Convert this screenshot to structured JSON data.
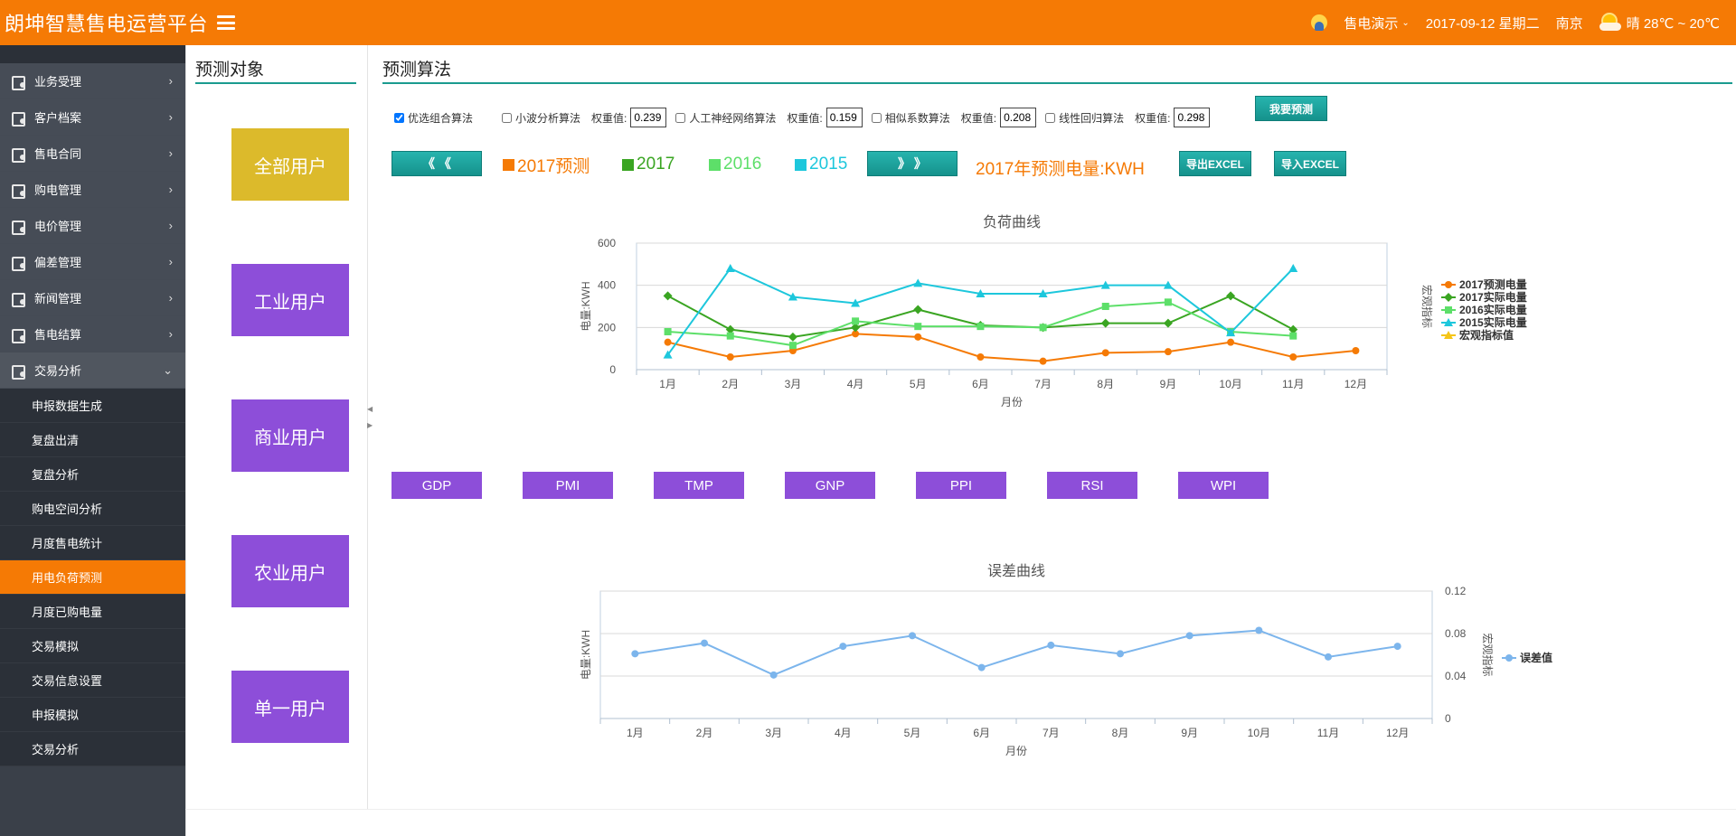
{
  "header": {
    "brand": "朗坤智慧售电运营平台",
    "user": "售电演示",
    "date": "2017-09-12 星期二",
    "city": "南京",
    "weather": "晴 28℃ ~ 20℃"
  },
  "sidebar": {
    "items": [
      {
        "label": "业务受理"
      },
      {
        "label": "客户档案"
      },
      {
        "label": "售电合同"
      },
      {
        "label": "购电管理"
      },
      {
        "label": "电价管理"
      },
      {
        "label": "偏差管理"
      },
      {
        "label": "新闻管理"
      },
      {
        "label": "售电结算"
      },
      {
        "label": "交易分析"
      }
    ],
    "subitems": [
      {
        "label": "申报数据生成"
      },
      {
        "label": "复盘出清"
      },
      {
        "label": "复盘分析"
      },
      {
        "label": "购电空间分析"
      },
      {
        "label": "月度售电统计"
      },
      {
        "label": "用电负荷预测"
      },
      {
        "label": "月度已购电量"
      },
      {
        "label": "交易模拟"
      },
      {
        "label": "交易信息设置"
      },
      {
        "label": "申报模拟"
      },
      {
        "label": "交易分析"
      }
    ]
  },
  "target_panel": {
    "title": "预测对象",
    "buttons": [
      "全部用户",
      "工业用户",
      "商业用户",
      "农业用户",
      "单一用户"
    ]
  },
  "algo_panel": {
    "title": "预测算法",
    "algorithms": [
      {
        "label": "优选组合算法",
        "checked": true
      },
      {
        "label": "小波分析算法",
        "checked": false,
        "weight_label": "权重值:",
        "weight": "0.239"
      },
      {
        "label": "人工神经网络算法",
        "checked": false,
        "weight_label": "权重值:",
        "weight": "0.159"
      },
      {
        "label": "相似系数算法",
        "checked": false,
        "weight_label": "权重值:",
        "weight": "0.208"
      },
      {
        "label": "线性回归算法",
        "checked": false,
        "weight_label": "权重值:",
        "weight": "0.298"
      }
    ],
    "predict_btn": "我要预测",
    "prev_btn": "《 《",
    "next_btn": "》 》",
    "legend": [
      "2017预测",
      "2017",
      "2016",
      "2015"
    ],
    "unit_label": "2017年预测电量:KWH",
    "export_btn": "导出EXCEL",
    "import_btn": "导入EXCEL",
    "macro_buttons": [
      "GDP",
      "PMI",
      "TMP",
      "GNP",
      "PPI",
      "RSI",
      "WPI"
    ]
  },
  "colors": {
    "orange": "#f57a05",
    "green": "#3aa522",
    "lightgreen": "#5ddf69",
    "cyan": "#1dc7dc",
    "yellow": "#f5c518",
    "blue": "#7cb5ec",
    "purple": "#8d4ed9",
    "teal": "#1a9b8f"
  },
  "chart_data": [
    {
      "type": "line",
      "title": "负荷曲线",
      "xlabel": "月份",
      "ylabel": "电量:KWH",
      "y2label": "宏观指标",
      "categories": [
        "1月",
        "2月",
        "3月",
        "4月",
        "5月",
        "6月",
        "7月",
        "8月",
        "9月",
        "10月",
        "11月",
        "12月"
      ],
      "ylim": [
        0,
        600
      ],
      "yticks": [
        0,
        200,
        400,
        600
      ],
      "series": [
        {
          "name": "2017预测电量",
          "color": "#f57a05",
          "marker": "circle",
          "values": [
            130,
            60,
            90,
            170,
            155,
            60,
            40,
            80,
            85,
            130,
            60,
            90
          ]
        },
        {
          "name": "2017实际电量",
          "color": "#3aa522",
          "marker": "diamond",
          "values": [
            350,
            190,
            155,
            200,
            285,
            210,
            200,
            220,
            220,
            350,
            190,
            null
          ]
        },
        {
          "name": "2016实际电量",
          "color": "#5ddf69",
          "marker": "square",
          "values": [
            180,
            160,
            115,
            230,
            205,
            205,
            200,
            300,
            320,
            180,
            160,
            null
          ]
        },
        {
          "name": "2015实际电量",
          "color": "#1dc7dc",
          "marker": "triangle",
          "values": [
            70,
            480,
            345,
            315,
            410,
            360,
            360,
            400,
            400,
            175,
            480,
            null
          ]
        },
        {
          "name": "宏观指标值",
          "color": "#f5c518",
          "marker": "triangle",
          "values": []
        }
      ],
      "legend_position": "right"
    },
    {
      "type": "line",
      "title": "误差曲线",
      "xlabel": "月份",
      "ylabel": "电量:KWH",
      "y2label": "宏观指标",
      "categories": [
        "1月",
        "2月",
        "3月",
        "4月",
        "5月",
        "6月",
        "7月",
        "8月",
        "9月",
        "10月",
        "11月",
        "12月"
      ],
      "ylim": [
        0,
        0.12
      ],
      "yticks": [
        "0",
        "0.04",
        "0.08",
        "0.12"
      ],
      "series": [
        {
          "name": "误差值",
          "color": "#7cb5ec",
          "marker": "circle",
          "values": [
            0.061,
            0.071,
            0.041,
            0.068,
            0.078,
            0.048,
            0.069,
            0.061,
            0.078,
            0.083,
            0.058,
            0.068
          ]
        }
      ],
      "legend_position": "right"
    }
  ]
}
